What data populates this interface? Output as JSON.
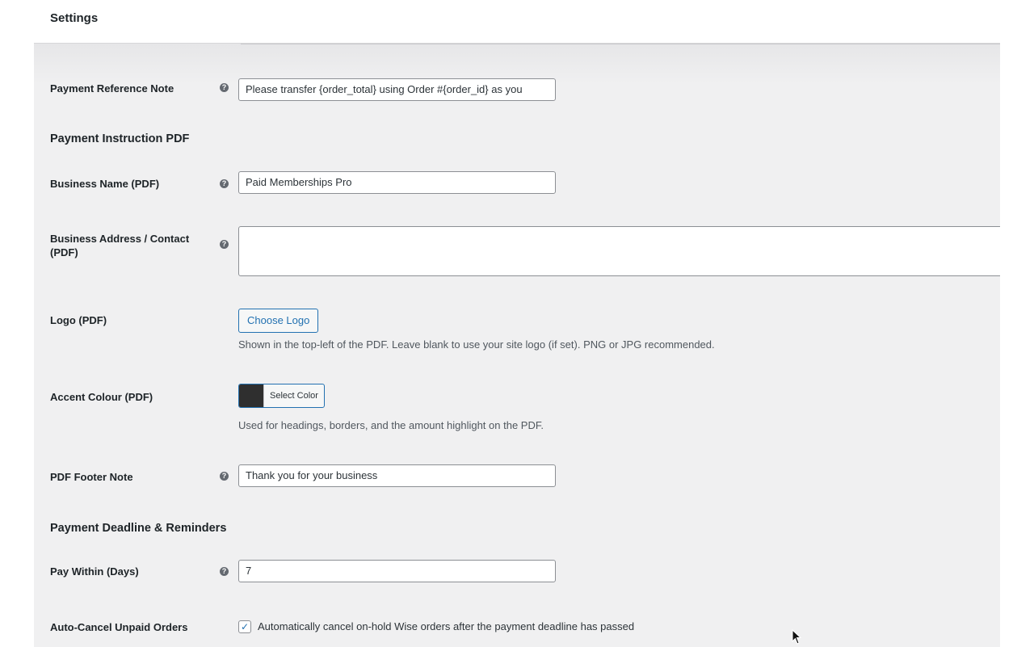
{
  "header": {
    "title": "Settings"
  },
  "fields": {
    "payment_reference_note": {
      "label": "Payment Reference Note",
      "value": "Please transfer {order_total} using Order #{order_id} as you"
    },
    "section_pdf": "Payment Instruction PDF",
    "business_name": {
      "label": "Business Name (PDF)",
      "value": "Paid Memberships Pro"
    },
    "business_address": {
      "label": "Business Address / Contact (PDF)",
      "value": ""
    },
    "logo": {
      "label": "Logo (PDF)",
      "button": "Choose Logo",
      "description": "Shown in the top-left of the PDF. Leave blank to use your site logo (if set). PNG or JPG recommended."
    },
    "accent_colour": {
      "label": "Accent Colour (PDF)",
      "button": "Select Color",
      "swatch_color": "#2f2f2f",
      "description": "Used for headings, borders, and the amount highlight on the PDF."
    },
    "pdf_footer_note": {
      "label": "PDF Footer Note",
      "value": "Thank you for your business"
    },
    "section_deadline": "Payment Deadline & Reminders",
    "pay_within": {
      "label": "Pay Within (Days)",
      "value": "7"
    },
    "auto_cancel": {
      "label": "Auto-Cancel Unpaid Orders",
      "checked": true,
      "text": "Automatically cancel on-hold Wise orders after the payment deadline has passed"
    }
  },
  "icons": {
    "help": "help-icon",
    "check": "checkmark-icon",
    "cursor": "mouse-pointer-icon"
  },
  "colors": {
    "accent": "#2271b1",
    "panel_bg": "#f0f0f1"
  }
}
